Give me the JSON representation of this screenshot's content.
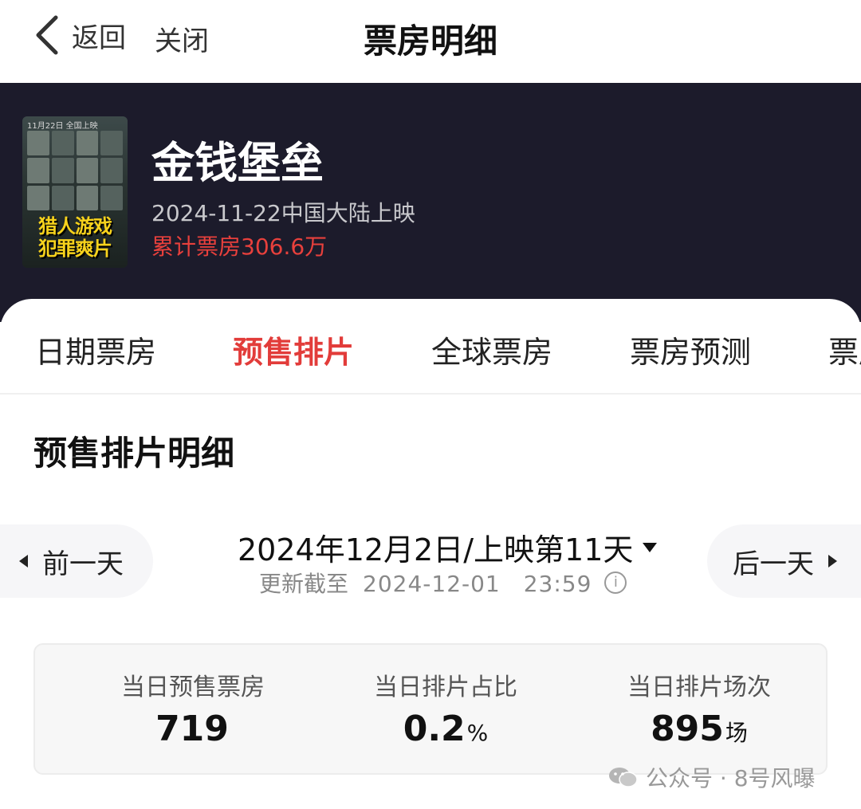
{
  "nav": {
    "back_label": "返回",
    "close_label": "关闭",
    "title": "票房明细"
  },
  "movie": {
    "poster": {
      "top_text": "11月22日 全国上映",
      "line1": "猎人游戏",
      "line2": "犯罪爽片"
    },
    "title": "金钱堡垒",
    "release_text": "2024-11-22中国大陆上映",
    "cumulative_box_office": "累计票房306.6万"
  },
  "tabs": [
    {
      "label": "日期票房",
      "active": false
    },
    {
      "label": "预售排片",
      "active": true
    },
    {
      "label": "全球票房",
      "active": false
    },
    {
      "label": "票房预测",
      "active": false
    },
    {
      "label": "票房",
      "active": false
    }
  ],
  "section_title": "预售排片明细",
  "date_nav": {
    "prev_label": "前一天",
    "next_label": "后一天",
    "current_date": "2024年12月2日/上映第11天",
    "update_prefix": "更新截至",
    "update_time": "2024-12-01　23:59",
    "info_glyph": "i"
  },
  "stats": [
    {
      "label": "当日预售票房",
      "value": "719",
      "unit": ""
    },
    {
      "label": "当日排片占比",
      "value": "0.2",
      "unit": "%"
    },
    {
      "label": "当日排片场次",
      "value": "895",
      "unit": "场"
    }
  ],
  "watermark": "公众号 · 8号风曝",
  "colors": {
    "accent_red": "#e23c3a",
    "hero_background": "#1c1b2b",
    "cumulative_text": "#e8403c"
  }
}
